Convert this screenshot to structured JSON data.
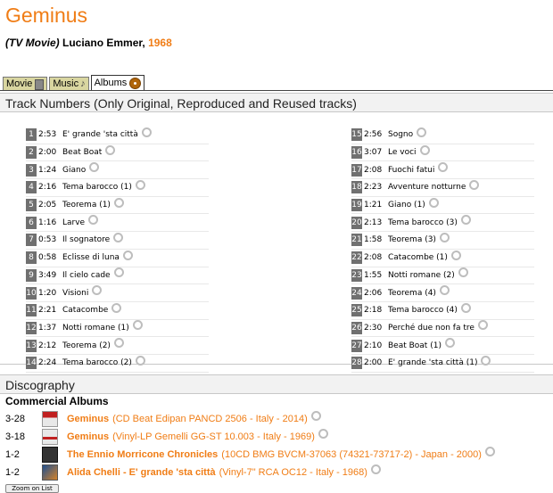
{
  "page": {
    "title": "Geminus",
    "kind": "(TV Movie)",
    "director": "Luciano Emmer,",
    "year": "1968"
  },
  "tabs": [
    {
      "label": "Movie",
      "icon": "film-icon"
    },
    {
      "label": "Music",
      "icon": "note-icon"
    },
    {
      "label": "Albums",
      "icon": "disc-icon",
      "active": true
    }
  ],
  "tracks_section": {
    "title": "Track Numbers (Only Original, Reproduced and Reused tracks)",
    "left": [
      {
        "num": "1",
        "time": "2:53",
        "title": "E' grande 'sta città"
      },
      {
        "num": "2",
        "time": "2:00",
        "title": "Beat Boat"
      },
      {
        "num": "3",
        "time": "1:24",
        "title": "Giano"
      },
      {
        "num": "4",
        "time": "2:16",
        "title": "Tema barocco (1)"
      },
      {
        "num": "5",
        "time": "2:05",
        "title": "Teorema (1)"
      },
      {
        "num": "6",
        "time": "1:16",
        "title": "Larve"
      },
      {
        "num": "7",
        "time": "0:53",
        "title": "Il sognatore"
      },
      {
        "num": "8",
        "time": "0:58",
        "title": "Eclisse di luna"
      },
      {
        "num": "9",
        "time": "3:49",
        "title": "Il cielo cade"
      },
      {
        "num": "10",
        "time": "1:20",
        "title": "Visioni"
      },
      {
        "num": "11",
        "time": "2:21",
        "title": "Catacombe"
      },
      {
        "num": "12",
        "time": "1:37",
        "title": "Notti romane (1)"
      },
      {
        "num": "13",
        "time": "2:12",
        "title": "Teorema (2)"
      },
      {
        "num": "14",
        "time": "2:24",
        "title": "Tema barocco (2)"
      }
    ],
    "right": [
      {
        "num": "15",
        "time": "2:56",
        "title": "Sogno"
      },
      {
        "num": "16",
        "time": "3:07",
        "title": "Le voci"
      },
      {
        "num": "17",
        "time": "2:08",
        "title": "Fuochi fatui"
      },
      {
        "num": "18",
        "time": "2:23",
        "title": "Avventure notturne"
      },
      {
        "num": "19",
        "time": "1:21",
        "title": "Giano (1)"
      },
      {
        "num": "20",
        "time": "2:13",
        "title": "Tema barocco (3)"
      },
      {
        "num": "21",
        "time": "1:58",
        "title": "Teorema (3)"
      },
      {
        "num": "22",
        "time": "2:08",
        "title": "Catacombe (1)"
      },
      {
        "num": "23",
        "time": "1:55",
        "title": "Notti romane (2)"
      },
      {
        "num": "24",
        "time": "2:06",
        "title": "Teorema (4)"
      },
      {
        "num": "25",
        "time": "2:18",
        "title": "Tema barocco (4)"
      },
      {
        "num": "26",
        "time": "2:30",
        "title": "Perché due non fa tre"
      },
      {
        "num": "27",
        "time": "2:10",
        "title": "Beat Boat (1)"
      },
      {
        "num": "28",
        "time": "2:00",
        "title": "E' grande 'sta città (1)"
      }
    ]
  },
  "discography": {
    "title": "Discography",
    "subtitle": "Commercial Albums",
    "albums": [
      {
        "range": "3-28",
        "name": "Geminus",
        "details": "(CD Beat Edipan PANCD 2506 - Italy - 2014)",
        "thumb": "th1"
      },
      {
        "range": "3-18",
        "name": "Geminus",
        "details": "(Vinyl-LP Gemelli GG-ST 10.003 - Italy - 1969)",
        "thumb": "th2"
      },
      {
        "range": "1-2",
        "name": "The Ennio Morricone Chronicles",
        "details": "(10CD BMG BVCM-37063 (74321-73717-2) - Japan - 2000)",
        "thumb": "th3"
      },
      {
        "range": "1-2",
        "name": "Alida Chelli - E' grande 'sta città",
        "details": "(Vinyl-7\" RCA OC12 - Italy - 1968)",
        "thumb": "th4"
      }
    ],
    "bottom_button": "Zoom on List"
  },
  "colors": {
    "accent": "#f07d16",
    "tab_bg": "#d9d6a0",
    "track_num_bg": "#707070"
  }
}
